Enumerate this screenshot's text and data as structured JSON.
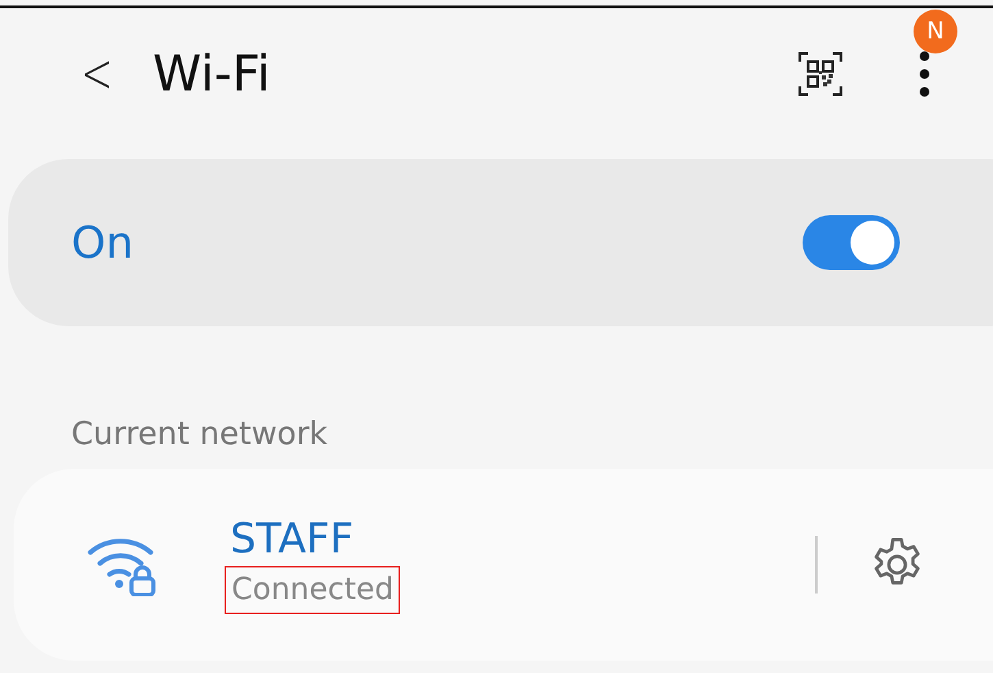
{
  "header": {
    "back": "<",
    "title": "Wi-Fi",
    "badge": "N"
  },
  "wifi_toggle": {
    "label": "On",
    "on": true
  },
  "section": {
    "title": "Current network"
  },
  "networks": [
    {
      "name": "STAFF",
      "status": "Connected",
      "highlighted": true
    }
  ]
}
